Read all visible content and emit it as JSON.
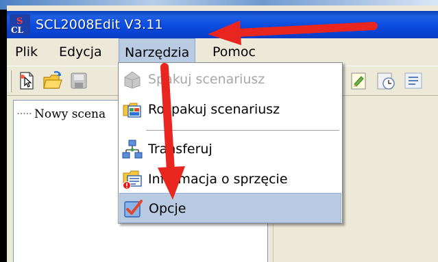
{
  "window": {
    "title": "SCL2008Edit V3.11",
    "title_bar_color": "#0a4be0"
  },
  "menubar": {
    "items": [
      {
        "label": "Plik"
      },
      {
        "label": "Edycja"
      },
      {
        "label": "Narzędzia",
        "active": true
      },
      {
        "label": "Pomoc"
      }
    ]
  },
  "toolbar": {
    "icons": [
      "new-file-icon",
      "open-folder-icon",
      "save-disk-icon",
      "edit-note-icon",
      "clock-icon",
      "settings-icon"
    ]
  },
  "tree": {
    "root_label": "Nowy scena"
  },
  "dropdown": {
    "highlight_color": "#b8cbe3",
    "items": [
      {
        "label": "Spakuj scenariusz",
        "icon": "pack-icon",
        "disabled": true
      },
      {
        "label": "Rozpakuj scenariusz",
        "icon": "unpack-icon",
        "disabled": false
      },
      {
        "label": "Transferuj",
        "icon": "network-transfer-icon",
        "disabled": false
      },
      {
        "label": "Informacja o sprzęcie",
        "icon": "hardware-info-icon",
        "disabled": false
      },
      {
        "label": "Opcje",
        "icon": "options-checkmark-icon",
        "disabled": false,
        "highlighted": true
      }
    ]
  },
  "annotations": {
    "arrow_color": "#e8261f"
  }
}
